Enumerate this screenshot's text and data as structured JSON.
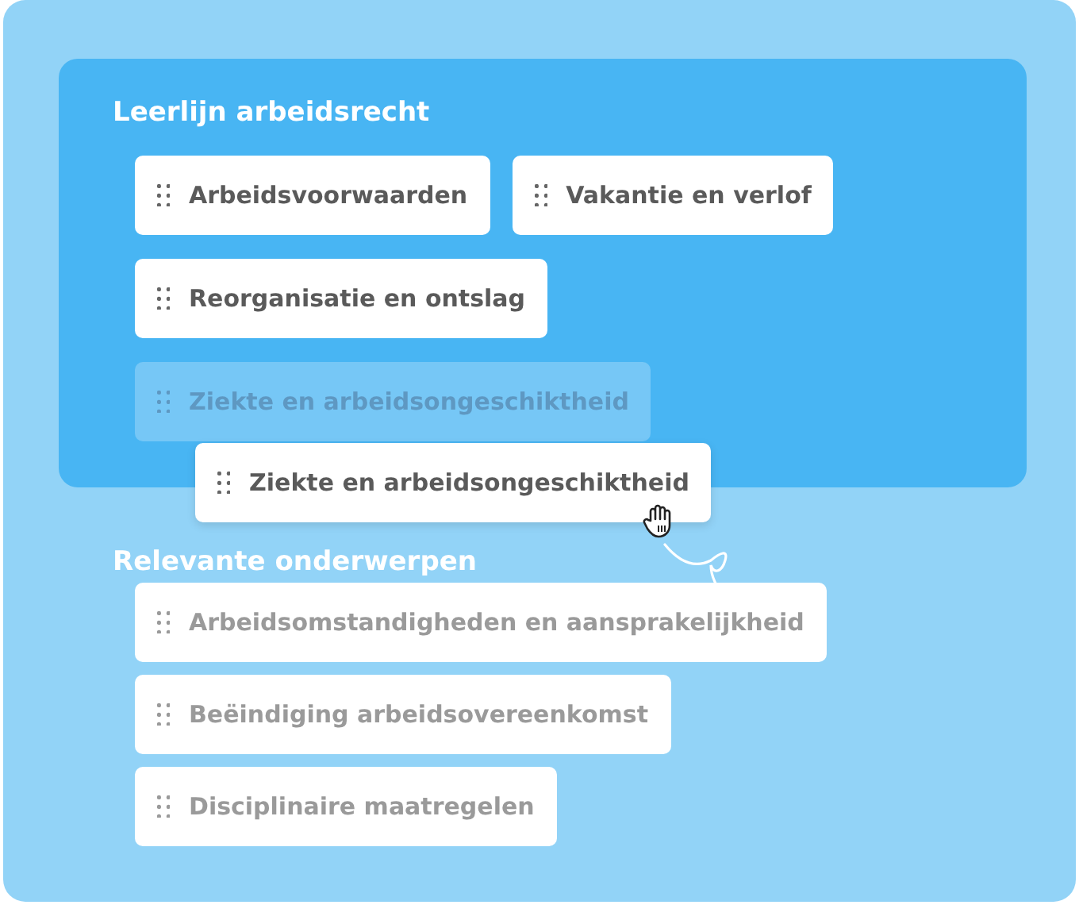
{
  "sections": [
    {
      "title": "Leerlijn arbeidsrecht",
      "kind": "primary",
      "items": [
        {
          "label": "Arbeidsvoorwaarden",
          "kind": "chip"
        },
        {
          "label": "Vakantie en verlof",
          "kind": "chip"
        },
        {
          "label": "Reorganisatie en ontslag",
          "kind": "chip"
        },
        {
          "label": "Ziekte en arbeidsongeschiktheid",
          "kind": "placeholder"
        }
      ],
      "dragged_item": {
        "label": "Ziekte en arbeidsongeschiktheid"
      }
    },
    {
      "title": "Relevante onderwerpen",
      "kind": "secondary",
      "items": [
        {
          "label": "Arbeidsomstandigheden en aansprakelijkheid",
          "kind": "chip"
        },
        {
          "label": "Beëindiging arbeidsovereenkomst",
          "kind": "chip"
        },
        {
          "label": "Disciplinaire maatregelen",
          "kind": "chip"
        }
      ]
    }
  ]
}
